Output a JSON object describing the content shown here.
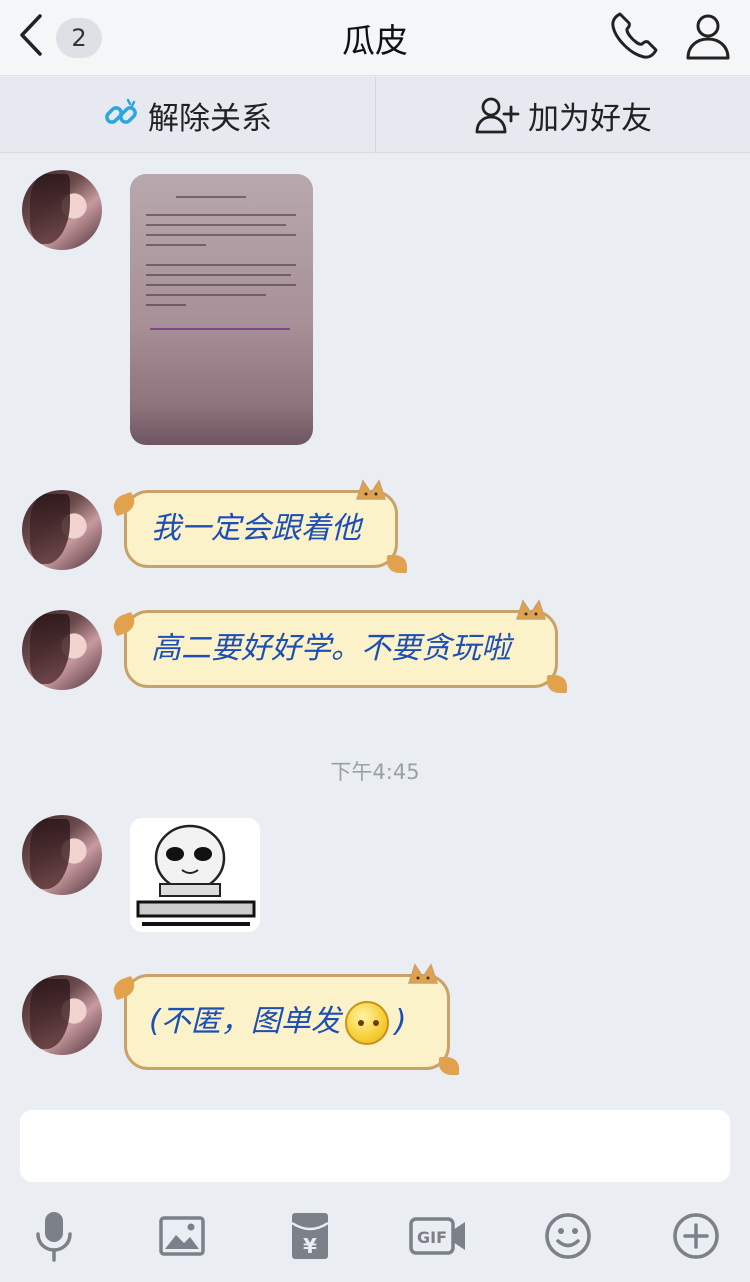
{
  "header": {
    "back_label": "back",
    "unread_count": "2",
    "title": "瓜皮"
  },
  "actions": {
    "unlink_label": "解除关系",
    "add_friend_label": "加为好友"
  },
  "messages": {
    "msg2": "我一定会跟着他",
    "msg3": "高二要好好学。不要贪玩啦",
    "time": "下午4:45",
    "msg5_prefix": "(不匿，图单发",
    "msg5_suffix": ")"
  },
  "icons": {
    "toolbar": [
      "microphone-icon",
      "image-icon",
      "red-packet-icon",
      "gif-icon",
      "emoji-icon",
      "plus-icon"
    ]
  },
  "colors": {
    "accent": "#1c4fb5",
    "bubble": "#fcf2c9",
    "background": "#eaedf2"
  }
}
